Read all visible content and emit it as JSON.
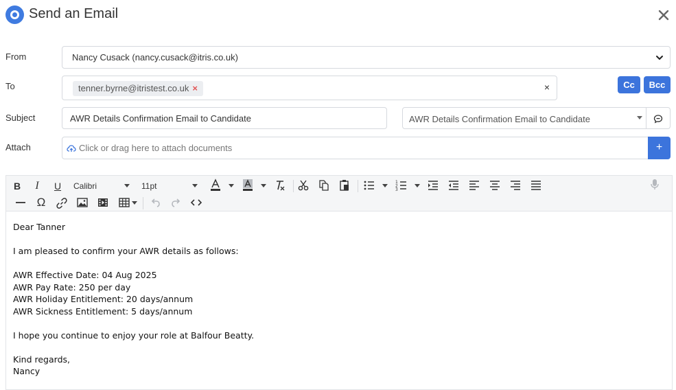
{
  "header": {
    "title": "Send an Email"
  },
  "labels": {
    "from": "From",
    "to": "To",
    "subject": "Subject",
    "attach": "Attach"
  },
  "from": {
    "value": "Nancy Cusack (nancy.cusack@itris.co.uk)"
  },
  "to": {
    "recipients": [
      "tenner.byrne@itristest.co.uk"
    ],
    "chip_remove": "×",
    "clear": "×"
  },
  "buttons": {
    "cc": "Cc",
    "bcc": "Bcc",
    "attach_add": "+"
  },
  "subject": {
    "value": "AWR Details Confirmation Email to Candidate"
  },
  "template": {
    "value": "AWR Details Confirmation Email to Candidate"
  },
  "attach": {
    "placeholder": "Click or drag here to attach documents"
  },
  "toolbar": {
    "font_family": "Calibri",
    "font_size": "11pt"
  },
  "editor": {
    "lines": [
      "Dear Tanner",
      "",
      "I am pleased to confirm your AWR details as follows:",
      "",
      "AWR Effective Date: 04 Aug 2025",
      "AWR Pay Rate: 250 per day",
      "AWR Holiday Entitlement: 20 days/annum",
      "AWR Sickness Entitlement: 5 days/annum",
      "",
      "I hope you continue to enjoy your role at Balfour Beatty.",
      "",
      "Kind regards,",
      "Nancy"
    ]
  },
  "colors": {
    "accent": "#3c74dc",
    "chip_remove": "#e25555"
  }
}
